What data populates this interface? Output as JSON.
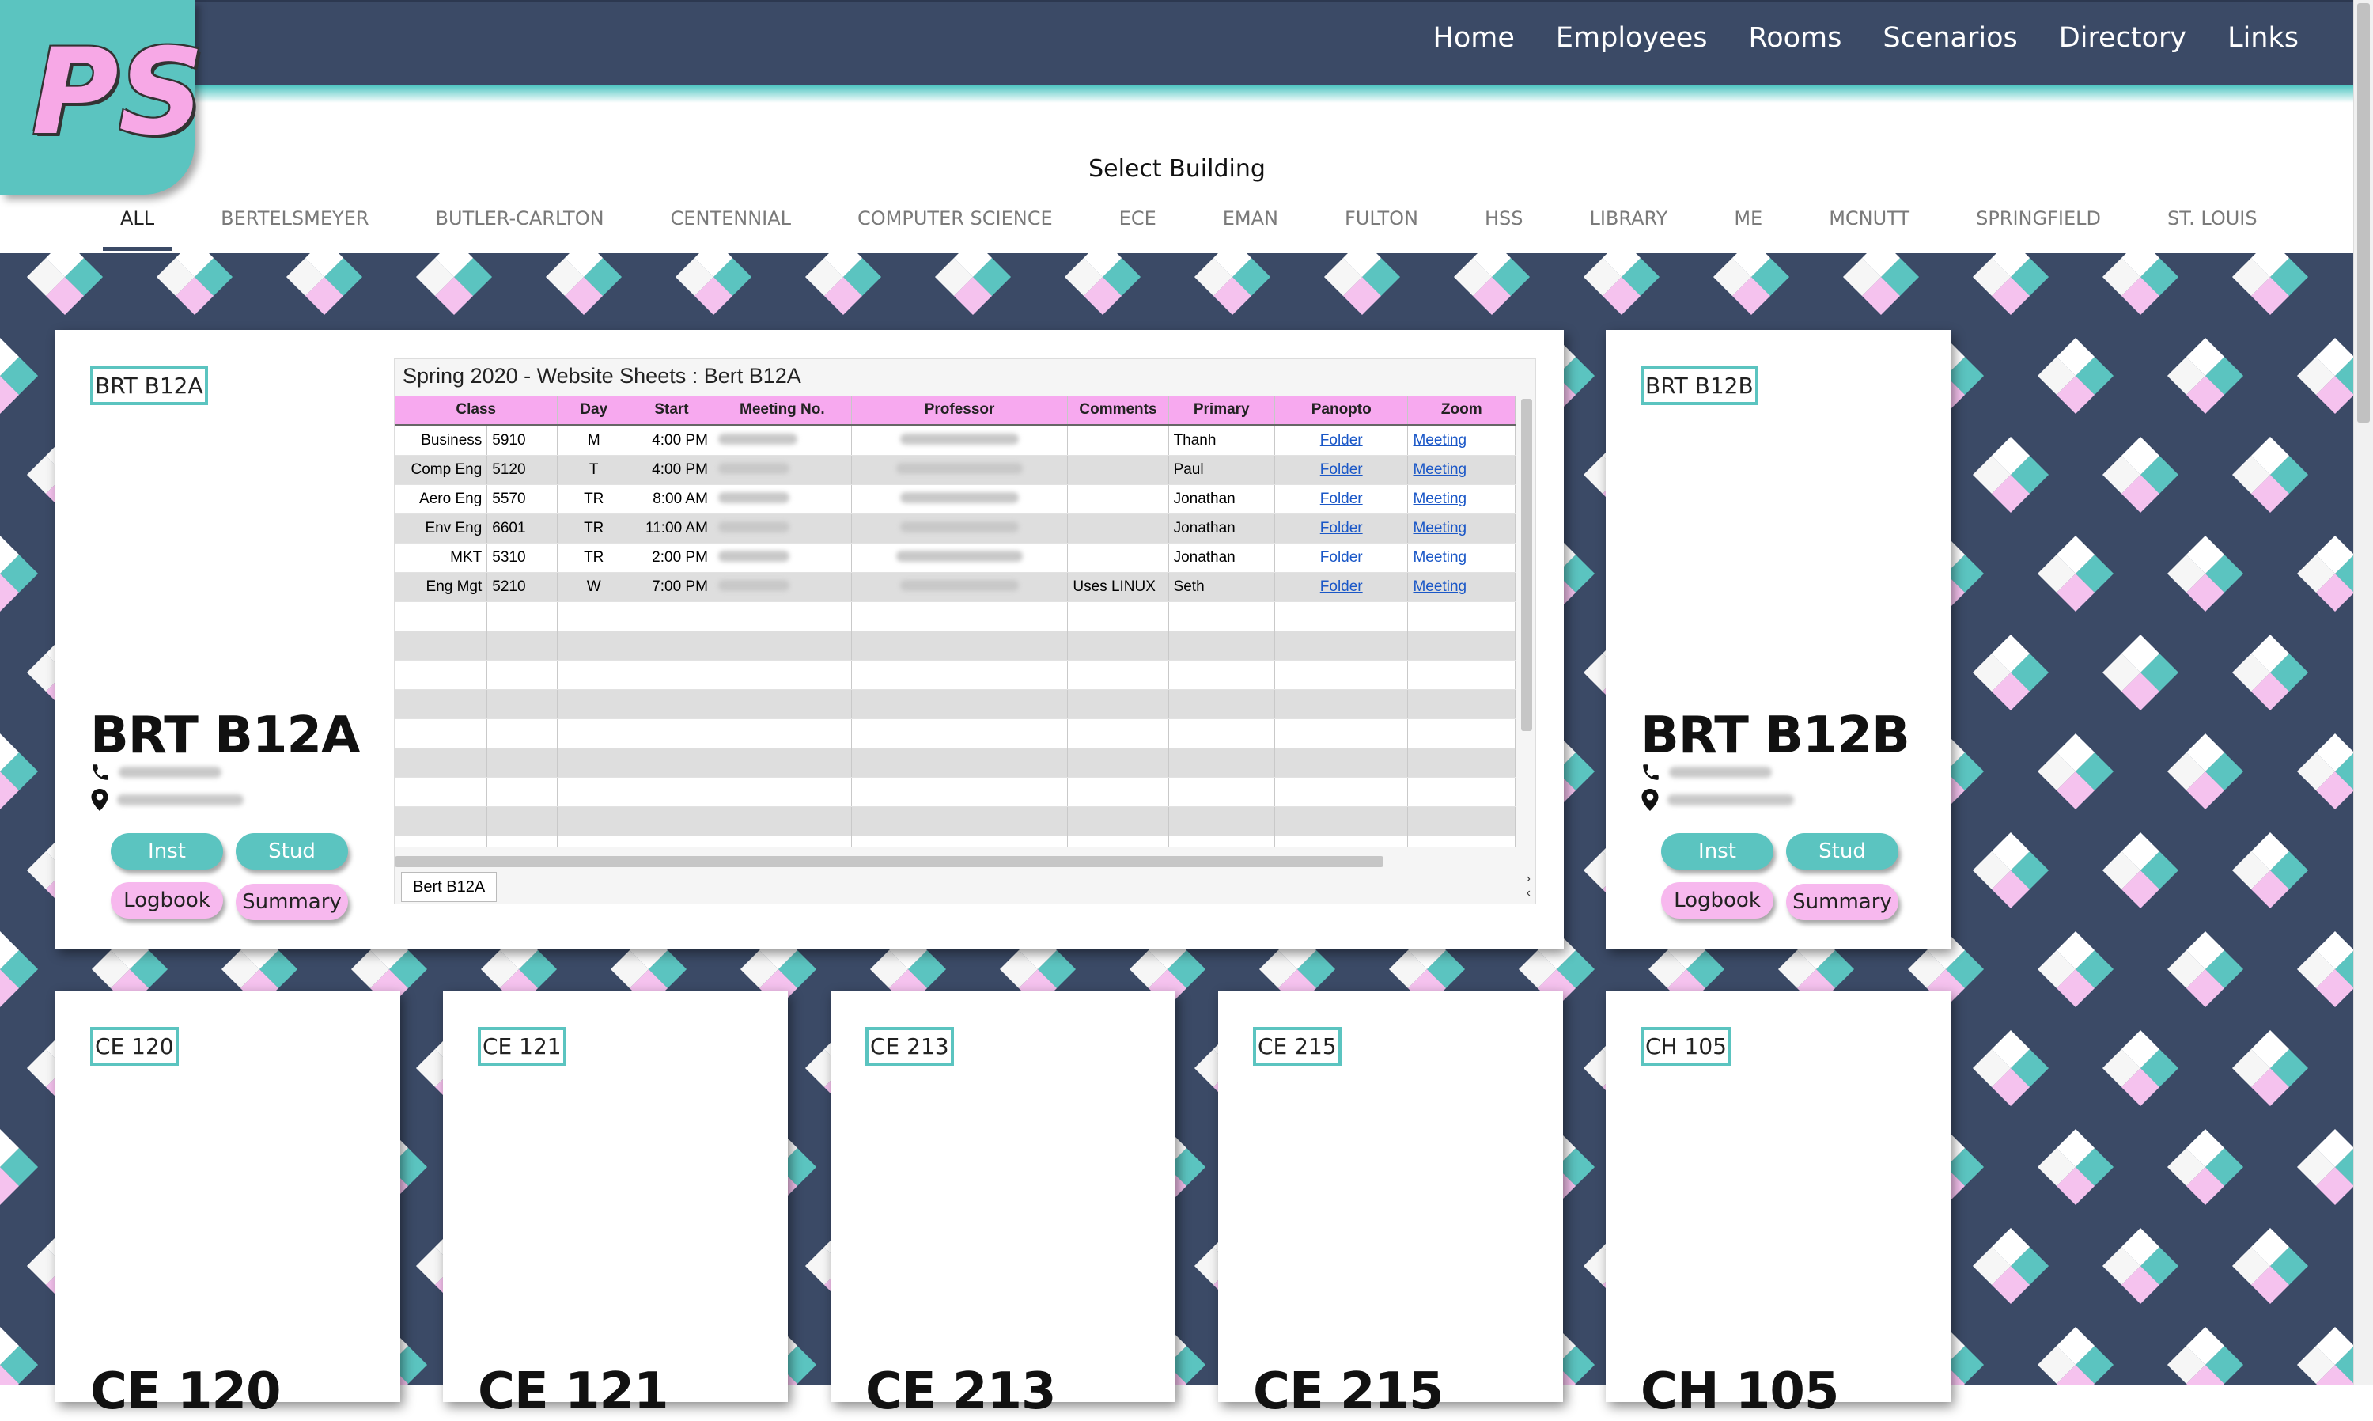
{
  "nav": {
    "logo_text": "PS",
    "items": [
      "Home",
      "Employees",
      "Rooms",
      "Scenarios",
      "Directory",
      "Links"
    ]
  },
  "building_select": {
    "title": "Select Building",
    "tabs": [
      "ALL",
      "BERTELSMEYER",
      "BUTLER-CARLTON",
      "CENTENNIAL",
      "COMPUTER SCIENCE",
      "ECE",
      "EMAN",
      "FULTON",
      "HSS",
      "LIBRARY",
      "ME",
      "MCNUTT",
      "SPRINGFIELD",
      "ST. LOUIS"
    ],
    "active": "ALL"
  },
  "rooms": [
    {
      "id": "brt-b12a",
      "image_alt": "BRT B12A",
      "name": "BRT B12A"
    },
    {
      "id": "brt-b12b",
      "image_alt": "BRT B12B",
      "name": "BRT B12B"
    },
    {
      "id": "ce-120",
      "image_alt": "CE 120",
      "name": "CE 120"
    },
    {
      "id": "ce-121",
      "image_alt": "CE 121",
      "name": "CE 121"
    },
    {
      "id": "ce-213",
      "image_alt": "CE 213",
      "name": "CE 213"
    },
    {
      "id": "ce-215",
      "image_alt": "CE 215",
      "name": "CE 215"
    },
    {
      "id": "ch-105",
      "image_alt": "CH 105",
      "name": "CH 105"
    }
  ],
  "buttons": {
    "inst": "Inst",
    "stud": "Stud",
    "logbook": "Logbook",
    "summary": "Summary"
  },
  "icons": {
    "phone": "phone-icon",
    "location": "map-marker-icon"
  },
  "colors": {
    "navy": "#3b4a66",
    "teal": "#5bc4c0",
    "pink": "#f7b8ee",
    "header_pink": "#f7a9ef"
  },
  "sheet": {
    "title": "Spring 2020 - Website Sheets : Bert B12A",
    "tab_label": "Bert B12A",
    "columns": [
      "Class",
      "Day",
      "Start",
      "Meeting No.",
      "Professor",
      "Comments",
      "Primary",
      "Panopto",
      "Zoom"
    ],
    "rows": [
      {
        "dept": "Business",
        "num": "5910",
        "day": "M",
        "start": "4:00 PM",
        "comments": "",
        "primary": "Thanh",
        "panopto": "Folder",
        "zoom": "Meeting"
      },
      {
        "dept": "Comp Eng",
        "num": "5120",
        "day": "T",
        "start": "4:00 PM",
        "comments": "",
        "primary": "Paul",
        "panopto": "Folder",
        "zoom": "Meeting"
      },
      {
        "dept": "Aero Eng",
        "num": "5570",
        "day": "TR",
        "start": "8:00 AM",
        "comments": "",
        "primary": "Jonathan",
        "panopto": "Folder",
        "zoom": "Meeting"
      },
      {
        "dept": "Env Eng",
        "num": "6601",
        "day": "TR",
        "start": "11:00 AM",
        "comments": "",
        "primary": "Jonathan",
        "panopto": "Folder",
        "zoom": "Meeting"
      },
      {
        "dept": "MKT",
        "num": "5310",
        "day": "TR",
        "start": "2:00 PM",
        "comments": "",
        "primary": "Jonathan",
        "panopto": "Folder",
        "zoom": "Meeting"
      },
      {
        "dept": "Eng Mgt",
        "num": "5210",
        "day": "W",
        "start": "7:00 PM",
        "comments": "Uses LINUX",
        "primary": "Seth",
        "panopto": "Folder",
        "zoom": "Meeting"
      }
    ]
  }
}
